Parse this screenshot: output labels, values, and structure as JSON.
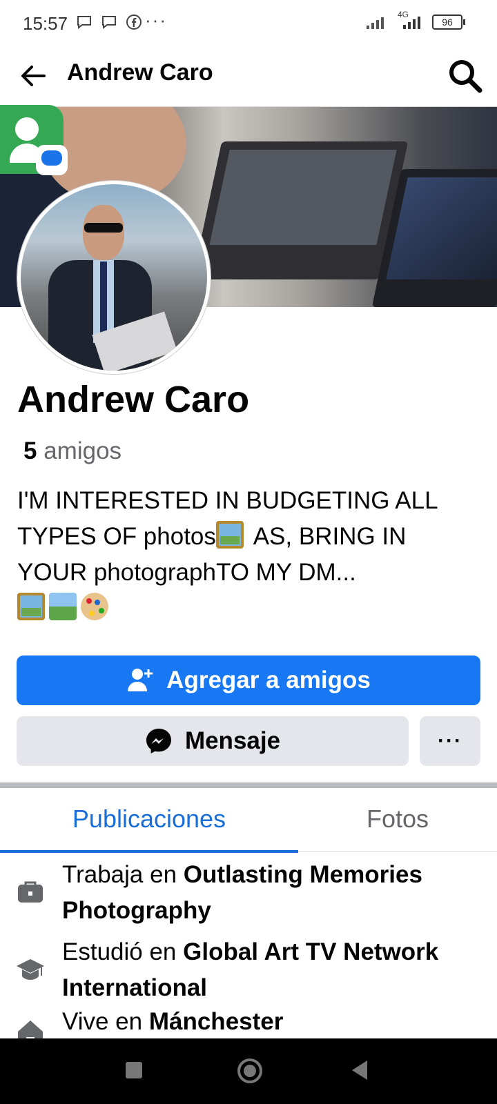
{
  "status_bar": {
    "time": "15:57",
    "overflow": "···",
    "network": "4G",
    "battery": "96"
  },
  "header": {
    "title": "Andrew Caro",
    "back_icon": "arrow-left-icon",
    "search_icon": "search-icon"
  },
  "profile": {
    "name": "Andrew Caro",
    "friends_count": "5",
    "friends_label": "amigos",
    "bio_line1": "I'M INTERESTED IN BUDGETING ALL",
    "bio_line2a": "TYPES OF photos",
    "bio_line2b": " AS, BRING IN",
    "bio_line3": "YOUR photographTO MY DM..."
  },
  "actions": {
    "add_friend_label": "Agregar a amigos",
    "message_label": "Mensaje",
    "more_label": "···"
  },
  "tabs": [
    {
      "label": "Publicaciones",
      "active": true
    },
    {
      "label": "Fotos",
      "active": false
    }
  ],
  "details": [
    {
      "icon": "briefcase-icon",
      "prefix": "Trabaja en ",
      "value": "Outlasting Memories Photography"
    },
    {
      "icon": "graduation-cap-icon",
      "prefix": "Estudió en ",
      "value": "Global Art TV Network International"
    },
    {
      "icon": "home-icon",
      "prefix": "Vive en ",
      "value": "Mánchester"
    }
  ],
  "colors": {
    "primary": "#1877f2",
    "tab_active": "#1a6ed8",
    "secondary_button": "#e4e6eb"
  }
}
